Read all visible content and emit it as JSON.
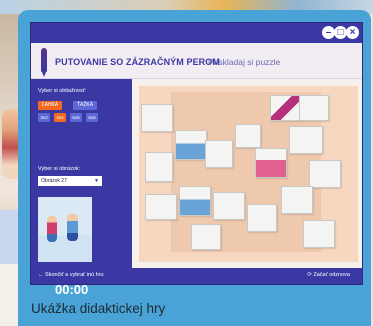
{
  "window": {
    "title": "PUTOVANIE SO ZÁZRAČNÝM PEROM",
    "subtitle": "Poskladaj si puzzle",
    "controls": [
      "minimize-icon",
      "maximize-icon",
      "close-icon"
    ]
  },
  "sidebar": {
    "difficulty_label": "Vyber si obtiažnosť:",
    "difficulty_options": [
      "ĽAHKÁ",
      "ŤAŽKÁ"
    ],
    "difficulty_selected": "ĽAHKÁ",
    "size_options": [
      "3x3",
      "4x4",
      "5x5",
      "6x6"
    ],
    "size_selected": "4x4",
    "picture_label": "Vyber si obrázok:",
    "picture_selected": "Obrázok 27",
    "timer": "00:00"
  },
  "footer": {
    "back_label": "Skončiť a vybrať inú hru",
    "restart_label": "Začať odznova"
  },
  "caption": "Ukážka didaktickej hry",
  "colors": {
    "frame": "#4aa3d6",
    "window_accent": "#3b38a4",
    "active_button": "#f26a22",
    "inactive_button": "#5c68d6",
    "puzzle_bg": "#f7d7bf"
  }
}
